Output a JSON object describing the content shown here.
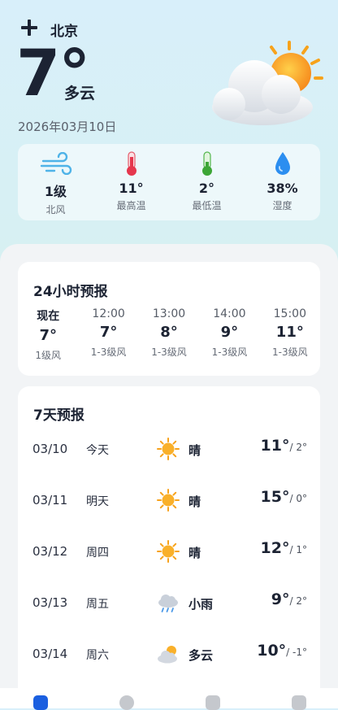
{
  "header": {
    "city": "北京",
    "temperature": "7°",
    "condition": "多云",
    "date": "2026年03月10日"
  },
  "stats": [
    {
      "icon": "wind-icon",
      "value": "1级",
      "label": "北风"
    },
    {
      "icon": "thermometer-high-icon",
      "value": "11°",
      "label": "最高温"
    },
    {
      "icon": "thermometer-low-icon",
      "value": "2°",
      "label": "最低温"
    },
    {
      "icon": "water-drop-icon",
      "value": "38%",
      "label": "湿度"
    }
  ],
  "hourly": {
    "title": "24小时预报",
    "items": [
      {
        "time": "现在",
        "temp": "7°",
        "wind": "1级风"
      },
      {
        "time": "12:00",
        "temp": "7°",
        "wind": "1-3级风"
      },
      {
        "time": "13:00",
        "temp": "8°",
        "wind": "1-3级风"
      },
      {
        "time": "14:00",
        "temp": "9°",
        "wind": "1-3级风"
      },
      {
        "time": "15:00",
        "temp": "11°",
        "wind": "1-3级风"
      }
    ]
  },
  "daily": {
    "title": "7天预报",
    "items": [
      {
        "date": "03/10",
        "weekday": "今天",
        "icon": "sun-icon",
        "condition": "晴",
        "high": "11°",
        "low": "/ 2°"
      },
      {
        "date": "03/11",
        "weekday": "明天",
        "icon": "sun-icon",
        "condition": "晴",
        "high": "15°",
        "low": "/ 0°"
      },
      {
        "date": "03/12",
        "weekday": "周四",
        "icon": "sun-icon",
        "condition": "晴",
        "high": "12°",
        "low": "/ 1°"
      },
      {
        "date": "03/13",
        "weekday": "周五",
        "icon": "rain-cloud-icon",
        "condition": "小雨",
        "high": "9°",
        "low": "/ 2°"
      },
      {
        "date": "03/14",
        "weekday": "周六",
        "icon": "partly-cloudy-icon",
        "condition": "多云",
        "high": "10°",
        "low": "/ -1°"
      }
    ]
  },
  "colors": {
    "accent": "#1a5fe0",
    "sun": "#f7a21b",
    "drop": "#2b8ef0"
  }
}
